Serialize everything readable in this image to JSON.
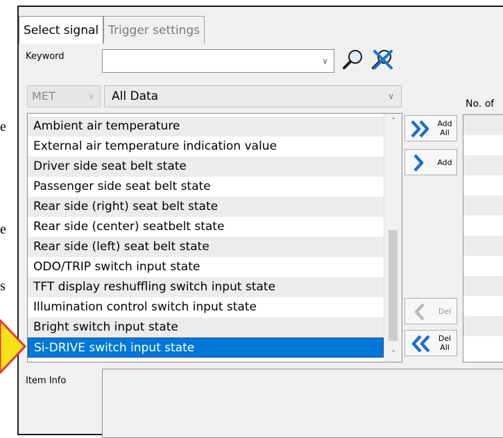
{
  "edge_fragments": [
    "e",
    "e",
    "s"
  ],
  "tabs": [
    {
      "label": "Select signal",
      "active": true
    },
    {
      "label": "Trigger settings",
      "active": false
    }
  ],
  "keyword": {
    "label": "Keyword",
    "value": "",
    "placeholder": ""
  },
  "filters": {
    "met": "MET",
    "data": "All Data"
  },
  "right_header": "No. of",
  "signals": [
    "Ambient air temperature",
    "External air temperature indication value",
    "Driver side seat belt state",
    "Passenger side seat belt state",
    "Rear side (right) seat belt state",
    "Rear side (center) seatbelt state",
    "Rear side (left) seat belt state",
    "ODO/TRIP switch input state",
    "TFT display reshuffling switch input state",
    "Illumination control switch input state",
    "Bright switch input state",
    "Si-DRIVE switch input state"
  ],
  "selected_index": 11,
  "buttons": {
    "add_all": [
      "Add",
      "All"
    ],
    "add": "Add",
    "del": "Del",
    "del_all": [
      "Del",
      "All"
    ]
  },
  "item_info": {
    "label": "Item Info",
    "value": ""
  },
  "colors": {
    "selection": "#0078d7",
    "arrow_blue": "#1e6fc9",
    "callout": "#f5e21b"
  },
  "icons": [
    "search-icon",
    "clear-search-icon",
    "double-chevron-right-icon",
    "chevron-right-icon",
    "chevron-left-icon",
    "double-chevron-left-icon",
    "callout-arrow-icon"
  ]
}
